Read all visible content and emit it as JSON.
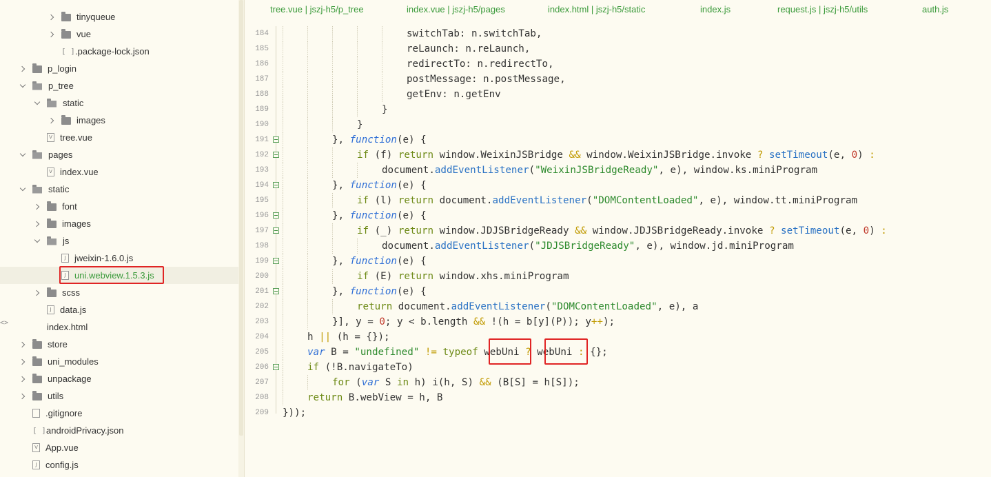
{
  "tree": [
    {
      "label": "tinyqueue",
      "type": "folder",
      "chevron": "right",
      "depth": 2
    },
    {
      "label": "vue",
      "type": "folder",
      "chevron": "right",
      "depth": 2
    },
    {
      "label": ".package-lock.json",
      "type": "json",
      "chevron": "none",
      "depth": 2
    },
    {
      "label": "p_login",
      "type": "folder",
      "chevron": "right",
      "depth": 0
    },
    {
      "label": "p_tree",
      "type": "folder-open",
      "chevron": "down",
      "depth": 0
    },
    {
      "label": "static",
      "type": "folder-open",
      "chevron": "down",
      "depth": 1
    },
    {
      "label": "images",
      "type": "folder",
      "chevron": "right",
      "depth": 2
    },
    {
      "label": "tree.vue",
      "type": "vue",
      "chevron": "none",
      "depth": 1
    },
    {
      "label": "pages",
      "type": "folder-open",
      "chevron": "down",
      "depth": 0
    },
    {
      "label": "index.vue",
      "type": "vue",
      "chevron": "none",
      "depth": 1
    },
    {
      "label": "static",
      "type": "folder-open",
      "chevron": "down",
      "depth": 0
    },
    {
      "label": "font",
      "type": "folder",
      "chevron": "right",
      "depth": 1
    },
    {
      "label": "images",
      "type": "folder",
      "chevron": "right",
      "depth": 1
    },
    {
      "label": "js",
      "type": "folder-open",
      "chevron": "down",
      "depth": 1
    },
    {
      "label": "jweixin-1.6.0.js",
      "type": "js",
      "chevron": "none",
      "depth": 2
    },
    {
      "label": "uni.webview.1.5.3.js",
      "type": "js",
      "chevron": "none",
      "depth": 2,
      "selected": true
    },
    {
      "label": "scss",
      "type": "folder",
      "chevron": "right",
      "depth": 1
    },
    {
      "label": "data.js",
      "type": "js",
      "chevron": "none",
      "depth": 1
    },
    {
      "label": "index.html",
      "type": "html",
      "chevron": "none",
      "depth": 1
    },
    {
      "label": "store",
      "type": "folder",
      "chevron": "right",
      "depth": 0
    },
    {
      "label": "uni_modules",
      "type": "folder",
      "chevron": "right",
      "depth": 0
    },
    {
      "label": "unpackage",
      "type": "folder",
      "chevron": "right",
      "depth": 0
    },
    {
      "label": "utils",
      "type": "folder",
      "chevron": "right",
      "depth": 0
    },
    {
      "label": ".gitignore",
      "type": "file",
      "chevron": "none",
      "depth": 0
    },
    {
      "label": "androidPrivacy.json",
      "type": "json",
      "chevron": "none",
      "depth": 0
    },
    {
      "label": "App.vue",
      "type": "vue",
      "chevron": "none",
      "depth": 0
    },
    {
      "label": "config.js",
      "type": "js",
      "chevron": "none",
      "depth": 0
    }
  ],
  "tabs": [
    "tree.vue | jszj-h5/p_tree",
    "index.vue | jszj-h5/pages",
    "index.html | jszj-h5/static",
    "index.js",
    "request.js | jszj-h5/utils",
    "auth.js"
  ],
  "lines": [
    {
      "n": "184",
      "indent": 5,
      "fold": false,
      "tokens": [
        [
          "t",
          "switchTab: n.switchTab,"
        ]
      ]
    },
    {
      "n": "185",
      "indent": 5,
      "fold": false,
      "tokens": [
        [
          "t",
          "reLaunch: n.reLaunch,"
        ]
      ]
    },
    {
      "n": "186",
      "indent": 5,
      "fold": false,
      "tokens": [
        [
          "t",
          "redirectTo: n.redirectTo,"
        ]
      ]
    },
    {
      "n": "187",
      "indent": 5,
      "fold": false,
      "tokens": [
        [
          "t",
          "postMessage: n.postMessage,"
        ]
      ]
    },
    {
      "n": "188",
      "indent": 5,
      "fold": false,
      "tokens": [
        [
          "t",
          "getEnv: n.getEnv"
        ]
      ]
    },
    {
      "n": "189",
      "indent": 4,
      "fold": false,
      "tokens": [
        [
          "t",
          "}"
        ]
      ]
    },
    {
      "n": "190",
      "indent": 3,
      "fold": false,
      "tokens": [
        [
          "t",
          "}"
        ]
      ]
    },
    {
      "n": "191",
      "indent": 2,
      "fold": true,
      "tokens": [
        [
          "t",
          "}, "
        ],
        [
          "kwi",
          "function"
        ],
        [
          "t",
          "(e) {"
        ]
      ]
    },
    {
      "n": "192",
      "indent": 3,
      "fold": true,
      "tokens": [
        [
          "kw",
          "if"
        ],
        [
          "t",
          " (f) "
        ],
        [
          "kw",
          "return"
        ],
        [
          "t",
          " window.WeixinJSBridge "
        ],
        [
          "op",
          "&&"
        ],
        [
          "t",
          " window.WeixinJSBridge.invoke "
        ],
        [
          "op",
          "?"
        ],
        [
          "t",
          " "
        ],
        [
          "fn",
          "setTimeout"
        ],
        [
          "t",
          "(e, "
        ],
        [
          "num",
          "0"
        ],
        [
          "t",
          ") "
        ],
        [
          "op",
          ":"
        ]
      ]
    },
    {
      "n": "193",
      "indent": 4,
      "fold": false,
      "tokens": [
        [
          "t",
          "document."
        ],
        [
          "fn",
          "addEventListener"
        ],
        [
          "t",
          "("
        ],
        [
          "str",
          "\"WeixinJSBridgeReady\""
        ],
        [
          "t",
          ", e), window.ks.miniProgram"
        ]
      ]
    },
    {
      "n": "194",
      "indent": 2,
      "fold": true,
      "tokens": [
        [
          "t",
          "}, "
        ],
        [
          "kwi",
          "function"
        ],
        [
          "t",
          "(e) {"
        ]
      ]
    },
    {
      "n": "195",
      "indent": 3,
      "fold": false,
      "tokens": [
        [
          "kw",
          "if"
        ],
        [
          "t",
          " (l) "
        ],
        [
          "kw",
          "return"
        ],
        [
          "t",
          " document."
        ],
        [
          "fn",
          "addEventListener"
        ],
        [
          "t",
          "("
        ],
        [
          "str",
          "\"DOMContentLoaded\""
        ],
        [
          "t",
          ", e), window.tt.miniProgram"
        ]
      ]
    },
    {
      "n": "196",
      "indent": 2,
      "fold": true,
      "tokens": [
        [
          "t",
          "}, "
        ],
        [
          "kwi",
          "function"
        ],
        [
          "t",
          "(e) {"
        ]
      ]
    },
    {
      "n": "197",
      "indent": 3,
      "fold": true,
      "tokens": [
        [
          "kw",
          "if"
        ],
        [
          "t",
          " (_) "
        ],
        [
          "kw",
          "return"
        ],
        [
          "t",
          " window.JDJSBridgeReady "
        ],
        [
          "op",
          "&&"
        ],
        [
          "t",
          " window.JDJSBridgeReady.invoke "
        ],
        [
          "op",
          "?"
        ],
        [
          "t",
          " "
        ],
        [
          "fn",
          "setTimeout"
        ],
        [
          "t",
          "(e, "
        ],
        [
          "num",
          "0"
        ],
        [
          "t",
          ") "
        ],
        [
          "op",
          ":"
        ]
      ]
    },
    {
      "n": "198",
      "indent": 4,
      "fold": false,
      "tokens": [
        [
          "t",
          "document."
        ],
        [
          "fn",
          "addEventListener"
        ],
        [
          "t",
          "("
        ],
        [
          "str",
          "\"JDJSBridgeReady\""
        ],
        [
          "t",
          ", e), window.jd.miniProgram"
        ]
      ]
    },
    {
      "n": "199",
      "indent": 2,
      "fold": true,
      "tokens": [
        [
          "t",
          "}, "
        ],
        [
          "kwi",
          "function"
        ],
        [
          "t",
          "(e) {"
        ]
      ]
    },
    {
      "n": "200",
      "indent": 3,
      "fold": false,
      "tokens": [
        [
          "kw",
          "if"
        ],
        [
          "t",
          " (E) "
        ],
        [
          "kw",
          "return"
        ],
        [
          "t",
          " window.xhs.miniProgram"
        ]
      ]
    },
    {
      "n": "201",
      "indent": 2,
      "fold": true,
      "tokens": [
        [
          "t",
          "}, "
        ],
        [
          "kwi",
          "function"
        ],
        [
          "t",
          "(e) {"
        ]
      ]
    },
    {
      "n": "202",
      "indent": 3,
      "fold": false,
      "tokens": [
        [
          "kw",
          "return"
        ],
        [
          "t",
          " document."
        ],
        [
          "fn",
          "addEventListener"
        ],
        [
          "t",
          "("
        ],
        [
          "str",
          "\"DOMContentLoaded\""
        ],
        [
          "t",
          ", e), a"
        ]
      ]
    },
    {
      "n": "203",
      "indent": 2,
      "fold": false,
      "tokens": [
        [
          "t",
          "}], y = "
        ],
        [
          "num",
          "0"
        ],
        [
          "t",
          "; y < b.length "
        ],
        [
          "op",
          "&&"
        ],
        [
          "t",
          " !(h = b[y](P)); y"
        ],
        [
          "op",
          "++"
        ],
        [
          "t",
          ");"
        ]
      ]
    },
    {
      "n": "204",
      "indent": 1,
      "fold": false,
      "tokens": [
        [
          "t",
          "h "
        ],
        [
          "op",
          "||"
        ],
        [
          "t",
          " (h = {});"
        ]
      ]
    },
    {
      "n": "205",
      "indent": 1,
      "fold": false,
      "tokens": [
        [
          "kwi",
          "var"
        ],
        [
          "t",
          " B = "
        ],
        [
          "str",
          "\"undefined\""
        ],
        [
          "t",
          " "
        ],
        [
          "op",
          "!="
        ],
        [
          "t",
          " "
        ],
        [
          "kw",
          "typeof"
        ],
        [
          "t",
          " webUni "
        ],
        [
          "op",
          "?"
        ],
        [
          "t",
          " webUni "
        ],
        [
          "op",
          ":"
        ],
        [
          "t",
          " {};"
        ]
      ]
    },
    {
      "n": "206",
      "indent": 1,
      "fold": true,
      "tokens": [
        [
          "kw",
          "if"
        ],
        [
          "t",
          " (!B.navigateTo)"
        ]
      ]
    },
    {
      "n": "207",
      "indent": 2,
      "fold": false,
      "tokens": [
        [
          "kw",
          "for"
        ],
        [
          "t",
          " ("
        ],
        [
          "kwi",
          "var"
        ],
        [
          "t",
          " S "
        ],
        [
          "kw",
          "in"
        ],
        [
          "t",
          " h) i(h, S) "
        ],
        [
          "op",
          "&&"
        ],
        [
          "t",
          " (B[S] = h[S]);"
        ]
      ]
    },
    {
      "n": "208",
      "indent": 1,
      "fold": false,
      "tokens": [
        [
          "kw",
          "return"
        ],
        [
          "t",
          " B.webView = h, B"
        ]
      ]
    },
    {
      "n": "209",
      "indent": 0,
      "fold": false,
      "tokens": [
        [
          "t",
          "}));"
        ]
      ]
    }
  ]
}
